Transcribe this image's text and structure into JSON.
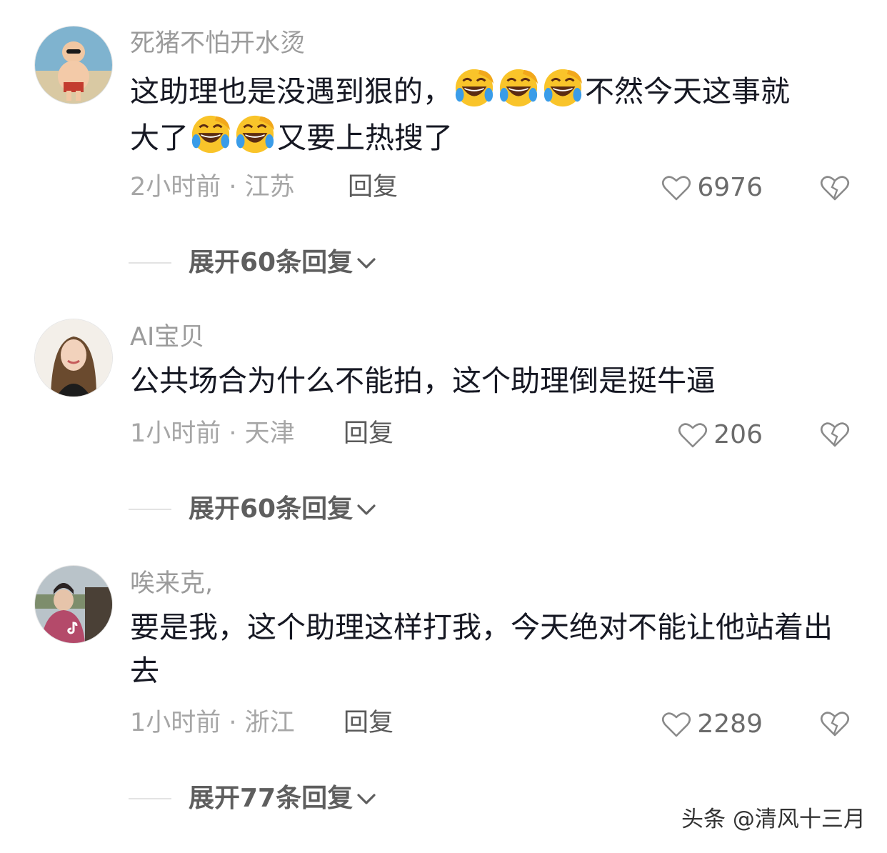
{
  "comments": [
    {
      "username": "死猪不怕开水烫",
      "text_part1": "这助理也是没遇到狠的，",
      "text_part2": "不然今天这事就",
      "text_part3": "大了",
      "text_part4": "又要上热搜了",
      "emoji": "rolling-laughing-crying-emoji",
      "meta": "2小时前 · 江苏",
      "reply_label": "回复",
      "likes": "6976",
      "expand_label": "展开60条回复"
    },
    {
      "username": "AI宝贝",
      "text": "公共场合为什么不能拍，这个助理倒是挺牛逼",
      "meta": "1小时前 · 天津",
      "reply_label": "回复",
      "likes": "206",
      "expand_label": "展开60条回复"
    },
    {
      "username": "唉来克,",
      "text": "要是我，这个助理这样打我，今天绝对不能让他站着出去",
      "meta": "1小时前 · 浙江",
      "reply_label": "回复",
      "likes": "2289",
      "expand_label": "展开77条回复"
    }
  ],
  "watermark": "头条 @清风十三月",
  "icons": {
    "like": "heart-outline-icon",
    "dislike": "broken-heart-icon",
    "expand": "chevron-down-icon"
  }
}
